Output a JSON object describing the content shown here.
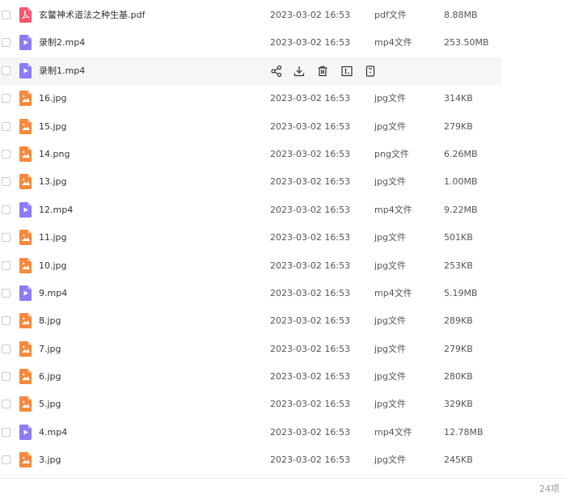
{
  "files": [
    {
      "name": "玄鳖神术道法之种生基.pdf",
      "date": "2023-03-02 16:53",
      "type": "pdf文件",
      "size": "8.88MB",
      "kind": "pdf"
    },
    {
      "name": "录制2.mp4",
      "date": "2023-03-02 16:53",
      "type": "mp4文件",
      "size": "253.50MB",
      "kind": "video"
    },
    {
      "name": "录制1.mp4",
      "date": "",
      "type": "",
      "size": "",
      "kind": "video",
      "hover": true
    },
    {
      "name": "16.jpg",
      "date": "2023-03-02 16:53",
      "type": "jpg文件",
      "size": "314KB",
      "kind": "image"
    },
    {
      "name": "15.jpg",
      "date": "2023-03-02 16:53",
      "type": "jpg文件",
      "size": "279KB",
      "kind": "image"
    },
    {
      "name": "14.png",
      "date": "2023-03-02 16:53",
      "type": "png文件",
      "size": "6.26MB",
      "kind": "image"
    },
    {
      "name": "13.jpg",
      "date": "2023-03-02 16:53",
      "type": "jpg文件",
      "size": "1.00MB",
      "kind": "image"
    },
    {
      "name": "12.mp4",
      "date": "2023-03-02 16:53",
      "type": "mp4文件",
      "size": "9.22MB",
      "kind": "video"
    },
    {
      "name": "11.jpg",
      "date": "2023-03-02 16:53",
      "type": "jpg文件",
      "size": "501KB",
      "kind": "image"
    },
    {
      "name": "10.jpg",
      "date": "2023-03-02 16:53",
      "type": "jpg文件",
      "size": "253KB",
      "kind": "image"
    },
    {
      "name": "9.mp4",
      "date": "2023-03-02 16:53",
      "type": "mp4文件",
      "size": "5.19MB",
      "kind": "video"
    },
    {
      "name": "8.jpg",
      "date": "2023-03-02 16:53",
      "type": "jpg文件",
      "size": "289KB",
      "kind": "image"
    },
    {
      "name": "7.jpg",
      "date": "2023-03-02 16:53",
      "type": "jpg文件",
      "size": "279KB",
      "kind": "image"
    },
    {
      "name": "6.jpg",
      "date": "2023-03-02 16:53",
      "type": "jpg文件",
      "size": "280KB",
      "kind": "image"
    },
    {
      "name": "5.jpg",
      "date": "2023-03-02 16:53",
      "type": "jpg文件",
      "size": "329KB",
      "kind": "image"
    },
    {
      "name": "4.mp4",
      "date": "2023-03-02 16:53",
      "type": "mp4文件",
      "size": "12.78MB",
      "kind": "video"
    },
    {
      "name": "3.jpg",
      "date": "2023-03-02 16:53",
      "type": "jpg文件",
      "size": "245KB",
      "kind": "image"
    }
  ],
  "row_actions": [
    "share-icon",
    "download-icon",
    "delete-icon",
    "rename-icon",
    "more-icon"
  ],
  "footer": {
    "count": "24项"
  },
  "colors": {
    "pdf": "#f2566b",
    "video": "#8b7cf6",
    "image": "#f5893c",
    "hover": "#f5f6f8"
  }
}
